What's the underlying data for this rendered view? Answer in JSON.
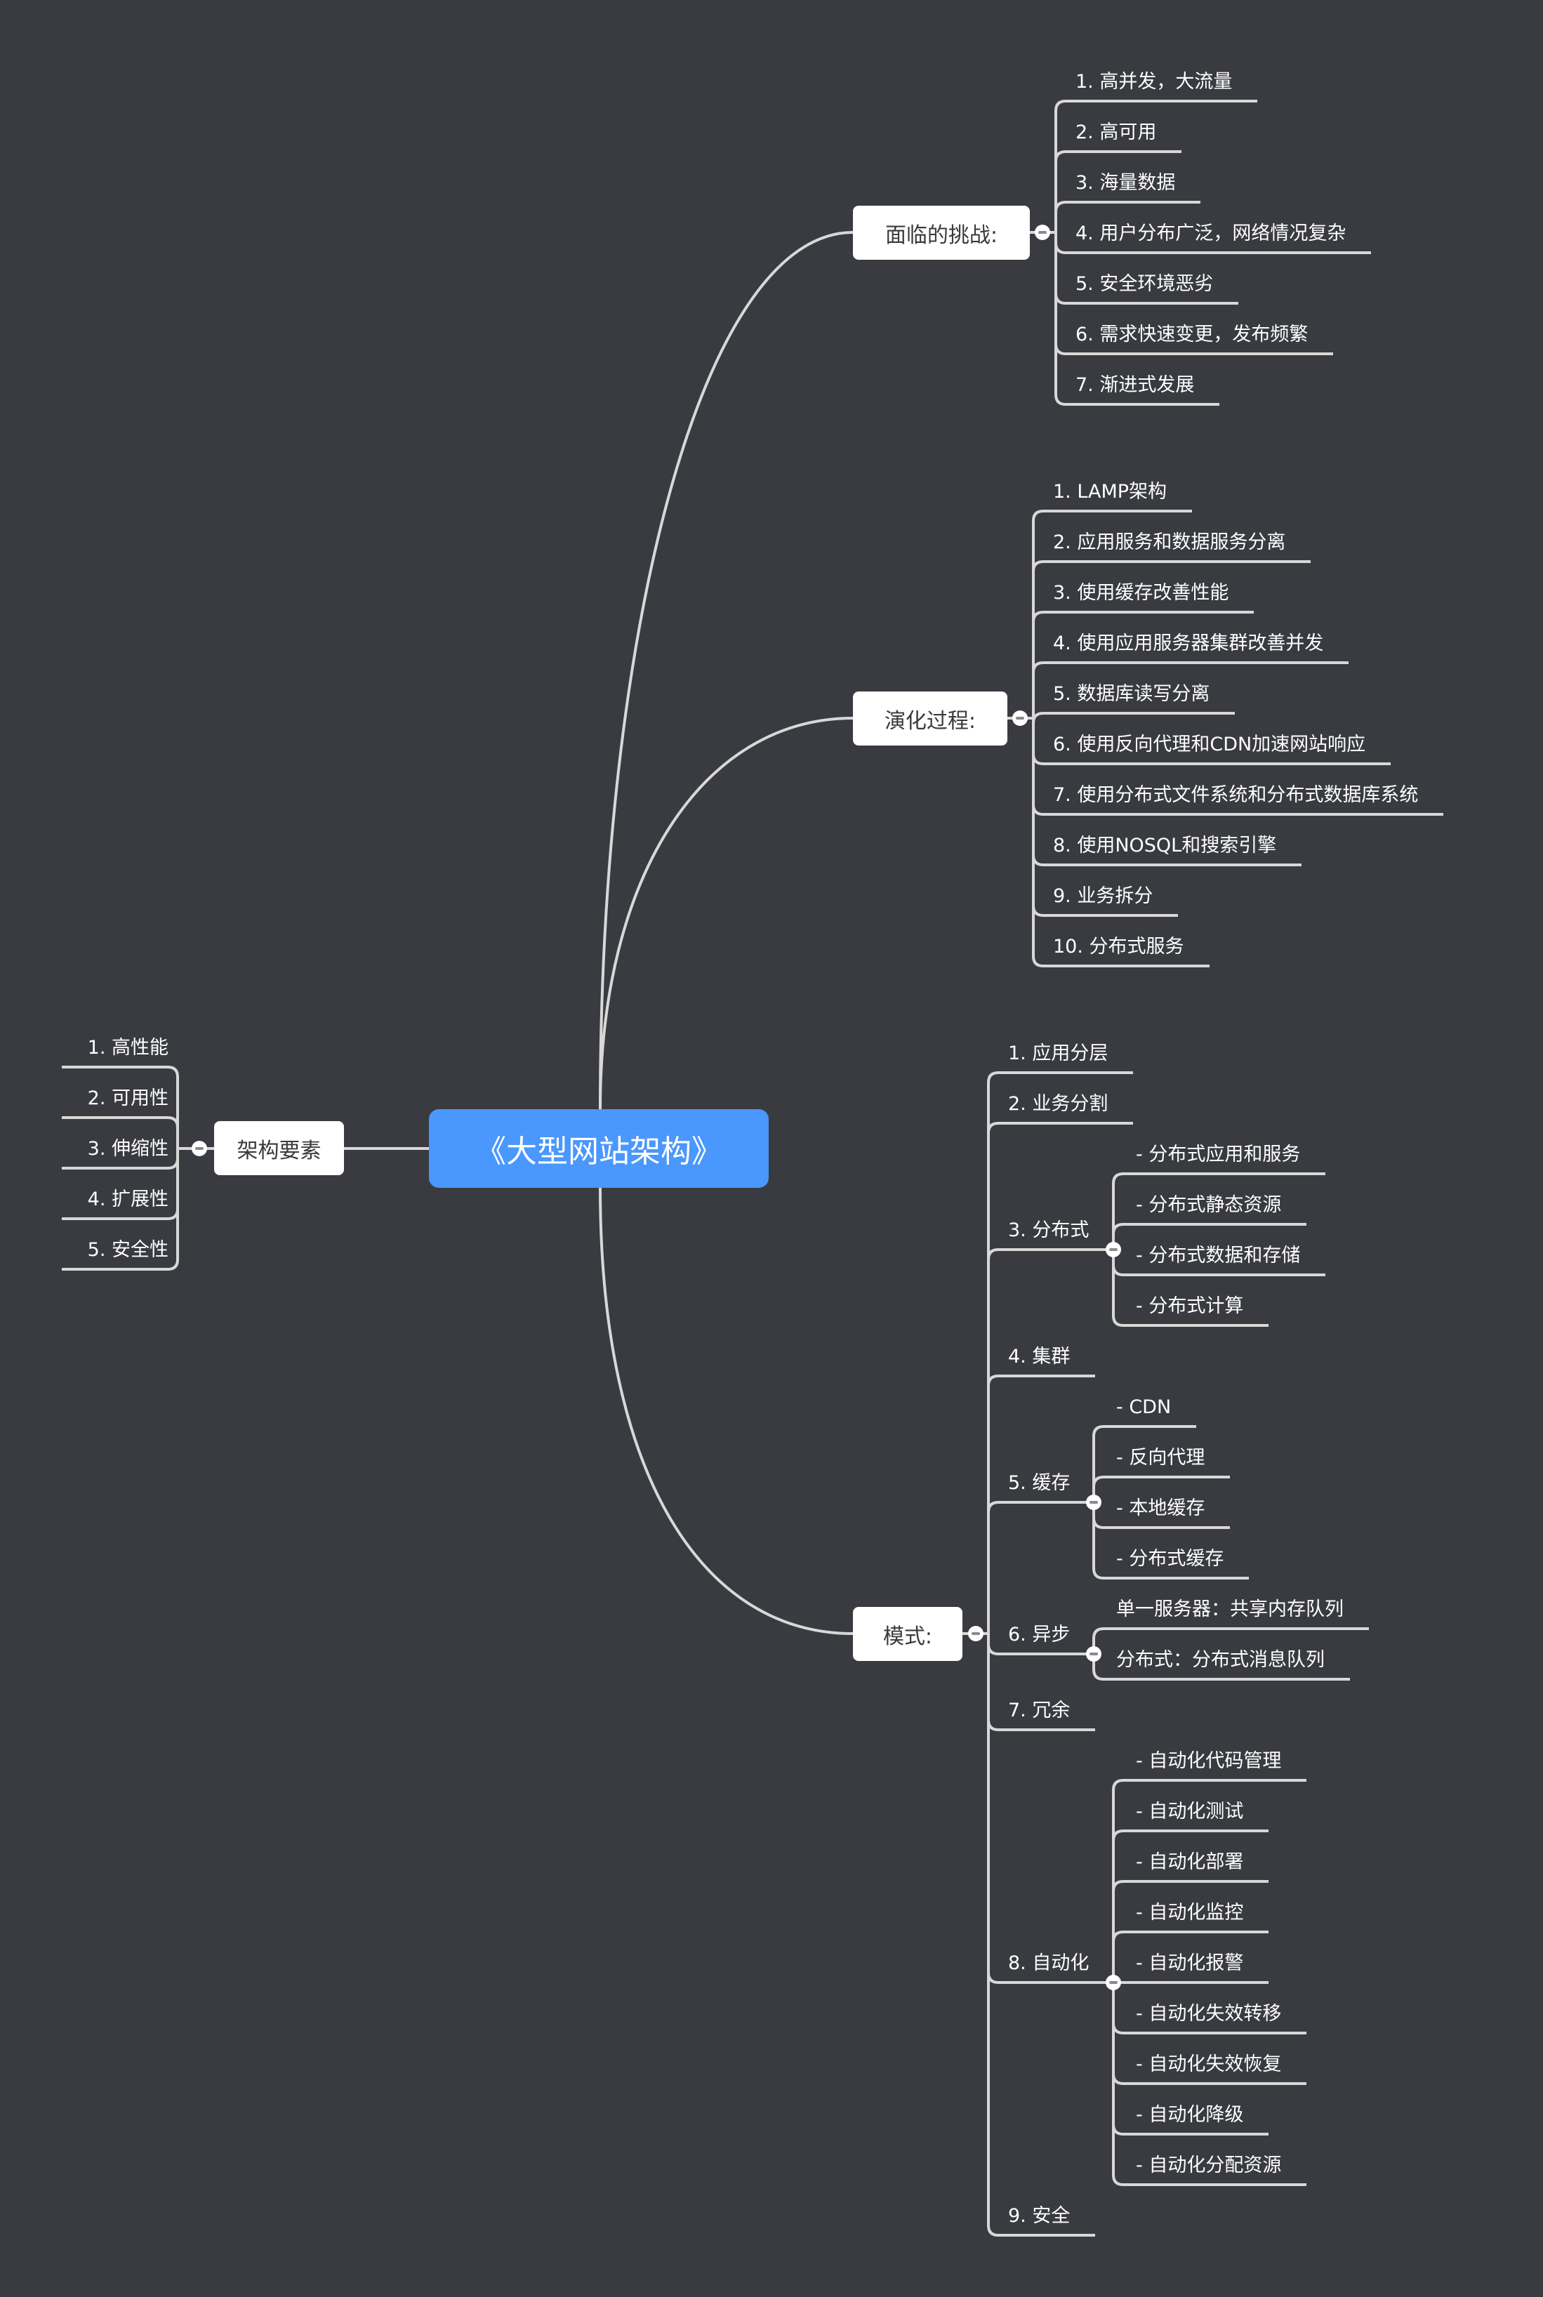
{
  "colors": {
    "background": "#393b40",
    "root_fill": "#4a97fd",
    "line": "#d8d8d8",
    "node_fill": "#ffffff",
    "node_text": "#3a3a3a",
    "leaf_text": "#ffffff"
  },
  "root": {
    "label": "《大型网站架构》"
  },
  "elements": {
    "label": "架构要素",
    "toggle_icon": "collapse-icon",
    "items": [
      "1. 高性能",
      "2. 可用性",
      "3. 伸缩性",
      "4. 扩展性",
      "5. 安全性"
    ]
  },
  "challenges": {
    "label": "面临的挑战:",
    "toggle_icon": "collapse-icon",
    "items": [
      "1. 高并发，大流量",
      "2. 高可用",
      "3. 海量数据",
      "4. 用户分布广泛，网络情况复杂",
      "5. 安全环境恶劣",
      "6. 需求快速变更，发布频繁",
      "7. 渐进式发展"
    ]
  },
  "evolution": {
    "label": "演化过程:",
    "toggle_icon": "collapse-icon",
    "items": [
      "1. LAMP架构",
      "2. 应用服务和数据服务分离",
      "3. 使用缓存改善性能",
      "4. 使用应用服务器集群改善并发",
      "5. 数据库读写分离",
      "6. 使用反向代理和CDN加速网站响应",
      "7. 使用分布式文件系统和分布式数据库系统",
      "8. 使用NOSQL和搜索引擎",
      "9. 业务拆分",
      "10. 分布式服务"
    ]
  },
  "patterns": {
    "label": "模式:",
    "toggle_icon": "collapse-icon",
    "items": [
      {
        "label": "1. 应用分层"
      },
      {
        "label": "2. 业务分割"
      },
      {
        "label": "3. 分布式",
        "children": [
          "- 分布式应用和服务",
          "- 分布式静态资源",
          "- 分布式数据和存储",
          "- 分布式计算"
        ]
      },
      {
        "label": "4. 集群"
      },
      {
        "label": "5. 缓存",
        "children": [
          "- CDN",
          "- 反向代理",
          "- 本地缓存",
          "- 分布式缓存"
        ]
      },
      {
        "label": "6. 异步",
        "children": [
          "单一服务器：共享内存队列",
          "分布式：分布式消息队列"
        ]
      },
      {
        "label": "7. 冗余"
      },
      {
        "label": "8. 自动化",
        "children": [
          "- 自动化代码管理",
          "- 自动化测试",
          "- 自动化部署",
          "- 自动化监控",
          "- 自动化报警",
          "- 自动化失效转移",
          "- 自动化失效恢复",
          "- 自动化降级",
          "- 自动化分配资源"
        ]
      },
      {
        "label": "9. 安全"
      }
    ]
  }
}
